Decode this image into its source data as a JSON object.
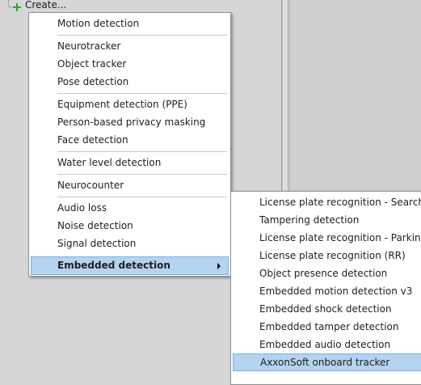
{
  "tree": {
    "create_label": "Create..."
  },
  "main_menu": {
    "items": [
      "Motion detection",
      "Neurotracker",
      "Object tracker",
      "Pose detection",
      "Equipment detection (PPE)",
      "Person-based privacy masking",
      "Face detection",
      "Water level detection",
      "Neurocounter",
      "Audio loss",
      "Noise detection",
      "Signal detection",
      "Embedded detection"
    ]
  },
  "sub_menu": {
    "items": [
      "License plate recognition - Search in",
      "Tampering detection",
      "License plate recognition - Parking",
      "License plate recognition (RR)",
      "Object presence detection",
      "Embedded motion detection v3",
      "Embedded shock detection",
      "Embedded tamper detection",
      "Embedded audio detection",
      "AxxonSoft onboard tracker"
    ]
  },
  "colors": {
    "highlight": "#b4d3f1",
    "highlight_border": "#7faee0",
    "plus_icon": "#2aa52a"
  }
}
